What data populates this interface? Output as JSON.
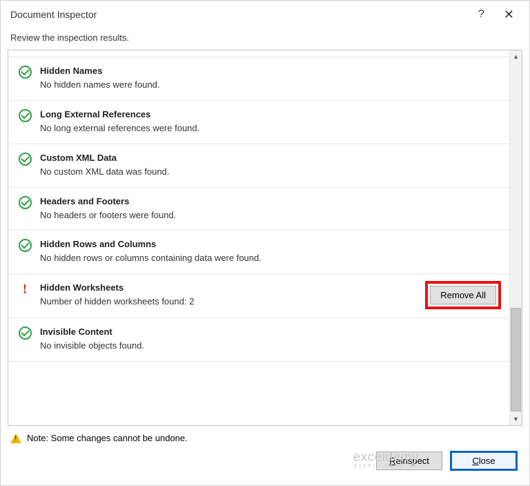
{
  "dialog": {
    "title": "Document Inspector",
    "help_tooltip": "?",
    "close_tooltip": "✕",
    "subheader": "Review the inspection results."
  },
  "items": [
    {
      "status": "ok",
      "title": "Hidden Names",
      "desc": "No hidden names were found."
    },
    {
      "status": "ok",
      "title": "Long External References",
      "desc": "No long external references were found."
    },
    {
      "status": "ok",
      "title": "Custom XML Data",
      "desc": "No custom XML data was found."
    },
    {
      "status": "ok",
      "title": "Headers and Footers",
      "desc": "No headers or footers were found."
    },
    {
      "status": "ok",
      "title": "Hidden Rows and Columns",
      "desc": "No hidden rows or columns containing data were found."
    },
    {
      "status": "warn",
      "title": "Hidden Worksheets",
      "desc": "Number of hidden worksheets found: 2",
      "action": "Remove All"
    },
    {
      "status": "ok",
      "title": "Invisible Content",
      "desc": "No invisible objects found."
    }
  ],
  "footer": {
    "note": "Note: Some changes cannot be undone.",
    "reinspect_prefix": "R",
    "reinspect_rest": "einspect",
    "close_prefix": "C",
    "close_rest": "lose"
  },
  "watermark": {
    "main": "exceldemy",
    "sub": "EXCEL · DATA · BI"
  }
}
